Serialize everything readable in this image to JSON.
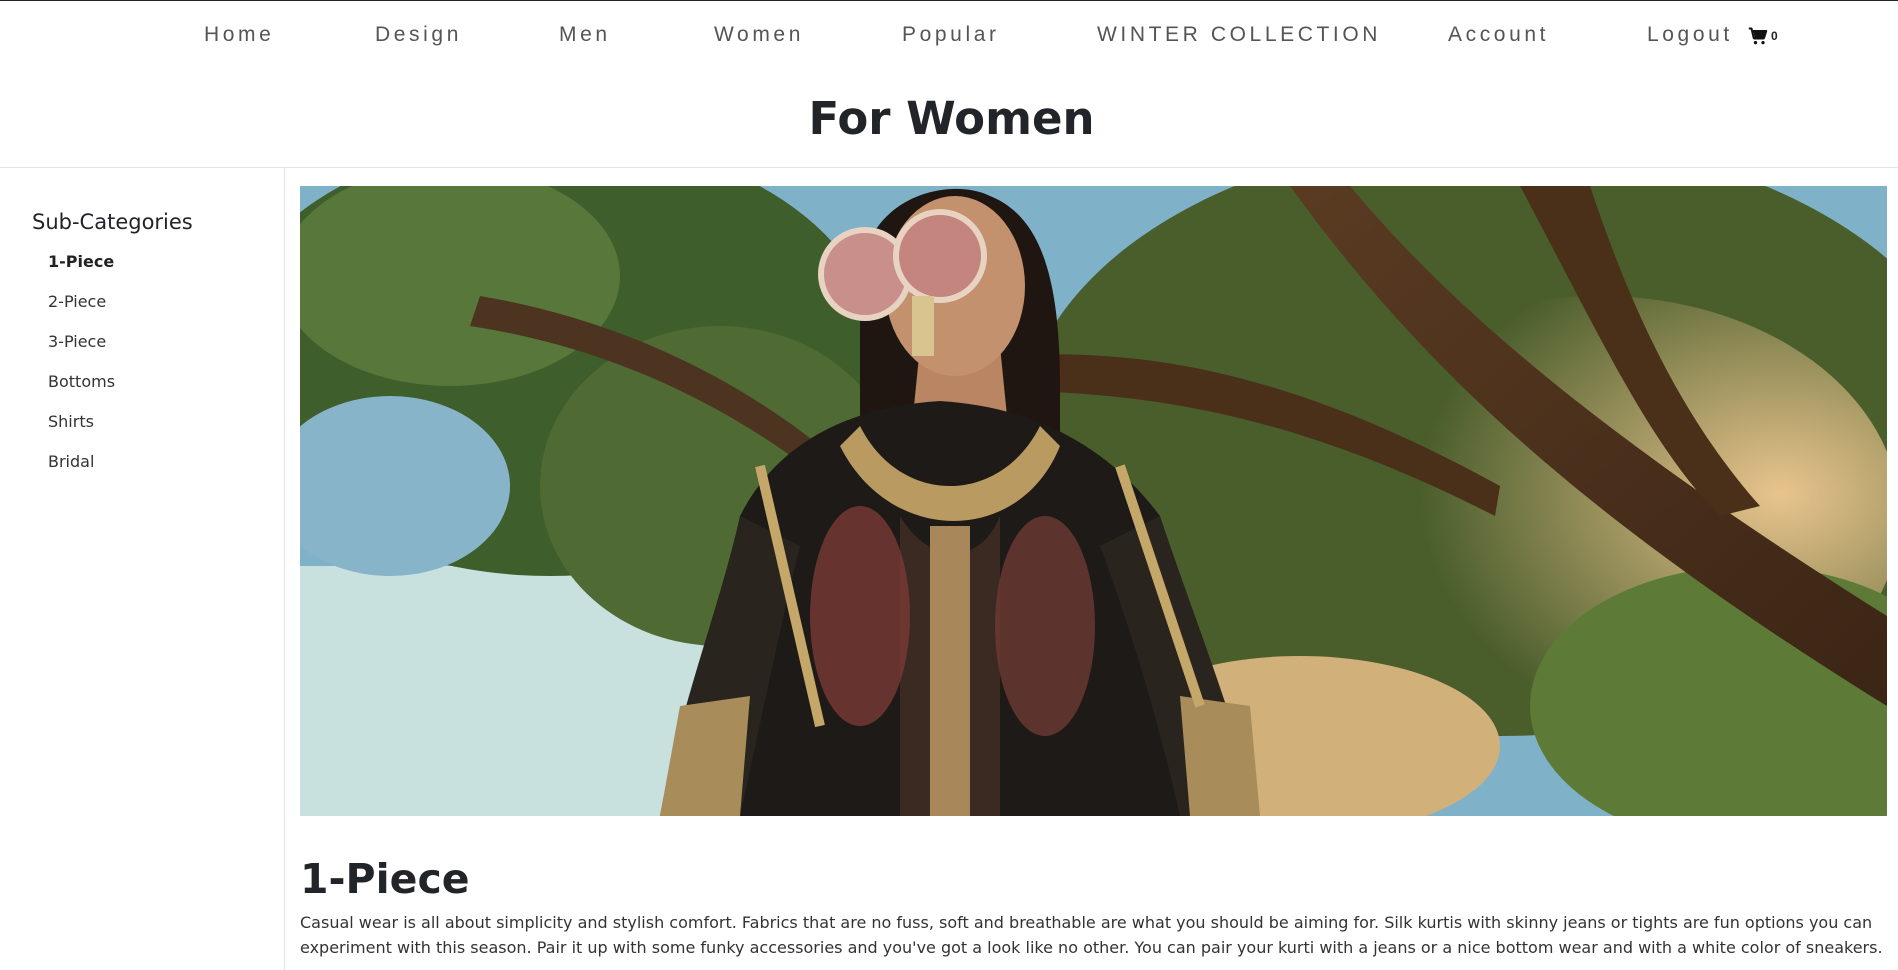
{
  "nav": {
    "items": [
      {
        "label": "Home"
      },
      {
        "label": "Design"
      },
      {
        "label": "Men"
      },
      {
        "label": "Women"
      },
      {
        "label": "Popular"
      },
      {
        "label": "WINTER COLLECTION"
      },
      {
        "label": "Account"
      },
      {
        "label": "Logout"
      }
    ],
    "cart_icon": "shopping-cart-icon",
    "cart_count": "0"
  },
  "page": {
    "title": "For Women"
  },
  "sidebar": {
    "title": "Sub-Categories",
    "items": [
      {
        "label": "1-Piece",
        "active": true
      },
      {
        "label": "2-Piece"
      },
      {
        "label": "3-Piece"
      },
      {
        "label": "Bottoms"
      },
      {
        "label": "Shirts"
      },
      {
        "label": "Bridal"
      }
    ]
  },
  "main": {
    "heading": "1-Piece",
    "description": "Casual wear is all about simplicity and stylish comfort. Fabrics that are no fuss, soft and breathable are what you should be aiming for. Silk kurtis with skinny jeans or tights are fun options you can experiment with this season. Pair it up with some funky accessories and you've got a look like no other. You can pair your kurti with a jeans or a nice bottom wear and with a white color of sneakers."
  }
}
